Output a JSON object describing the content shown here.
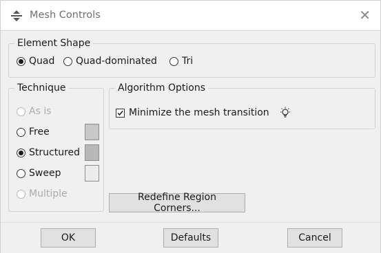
{
  "window": {
    "title": "Mesh Controls",
    "icon": "mesh-controls-icon",
    "close_icon": "close-icon"
  },
  "element_shape": {
    "legend": "Element Shape",
    "options": [
      "Quad",
      "Quad-dominated",
      "Tri"
    ],
    "selected": "Quad"
  },
  "technique": {
    "legend": "Technique",
    "options": [
      {
        "label": "As is",
        "enabled": false,
        "selected": false
      },
      {
        "label": "Free",
        "enabled": true,
        "selected": false,
        "swatch_color": "#c8c8c8"
      },
      {
        "label": "Structured",
        "enabled": true,
        "selected": true,
        "swatch_color": "#b8b8b8"
      },
      {
        "label": "Sweep",
        "enabled": true,
        "selected": false,
        "swatch_color": "#ececec"
      },
      {
        "label": "Multiple",
        "enabled": false,
        "selected": false
      }
    ]
  },
  "algorithm": {
    "legend": "Algorithm Options",
    "minimize_label": "Minimize the mesh transition",
    "minimize_checked": true,
    "hint_icon": "lightbulb-icon"
  },
  "redefine_button": "Redefine Region Corners...",
  "buttons": {
    "ok": "OK",
    "defaults": "Defaults",
    "cancel": "Cancel"
  }
}
